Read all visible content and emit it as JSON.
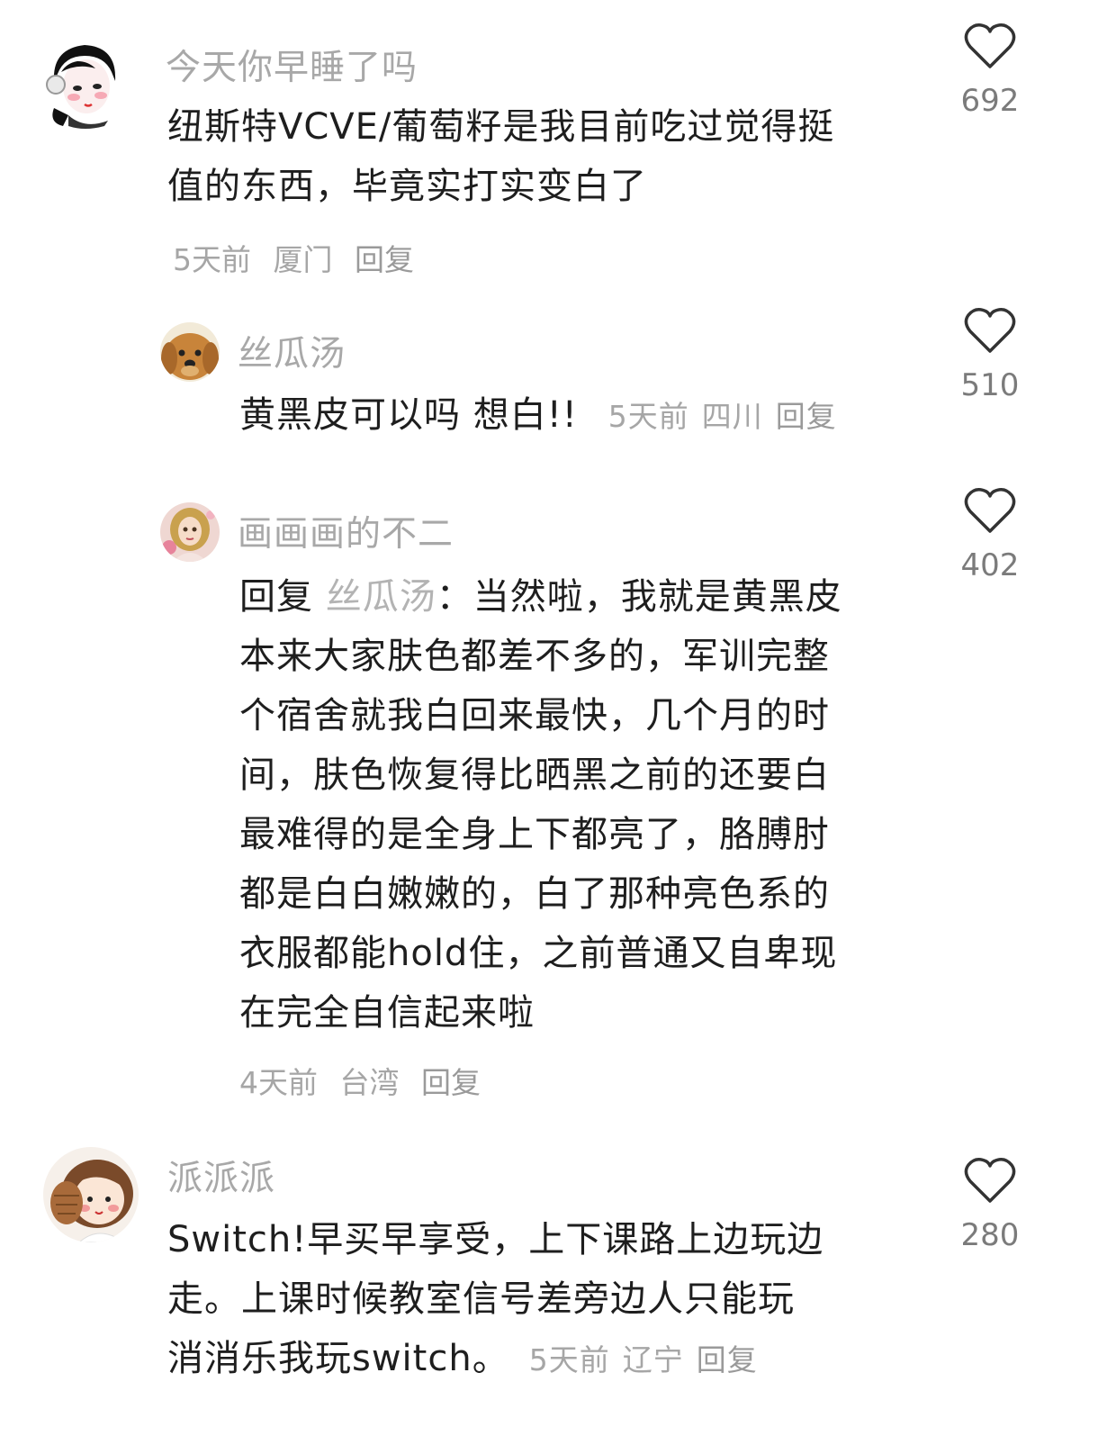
{
  "comments": [
    {
      "username": "今天你早睡了吗",
      "lines": [
        "纽斯特VCVE/葡萄籽是我目前吃过觉得挺",
        "值的东西，毕竟实打实变白了"
      ],
      "time": "5天前",
      "location": "厦门",
      "reply_label": "回复",
      "likes": "692",
      "avatar_icon": "anime-girl-avatar"
    },
    {
      "username": "丝瓜汤",
      "text": "黄黑皮可以吗 想白!!",
      "time": "5天前",
      "location": "四川",
      "reply_label": "回复",
      "likes": "510",
      "avatar_icon": "dog-avatar"
    },
    {
      "username": "画画画的不二",
      "reply_prefix": "回复",
      "mention": "丝瓜汤",
      "first_line_rest": "：当然啦，我就是黄黑皮",
      "lines": [
        "本来大家肤色都差不多的，军训完整",
        "个宿舍就我白回来最快，几个月的时",
        "间，肤色恢复得比晒黑之前的还要白",
        "最难得的是全身上下都亮了，胳膊肘",
        "都是白白嫩嫩的，白了那种亮色系的",
        "衣服都能hold住，之前普通又自卑现",
        "在完全自信起来啦"
      ],
      "time": "4天前",
      "location": "台湾",
      "reply_label": "回复",
      "likes": "402",
      "avatar_icon": "doll-avatar"
    },
    {
      "username": "派派派",
      "lines": [
        "Switch!早买早享受，上下课路上边玩边",
        "走。上课时候教室信号差旁边人只能玩"
      ],
      "last_line": "消消乐我玩switch。",
      "time": "5天前",
      "location": "辽宁",
      "reply_label": "回复",
      "likes": "280",
      "avatar_icon": "cartoon-girl-avatar"
    }
  ],
  "colors": {
    "username": "#a8a8a8",
    "text": "#1e1e1e",
    "meta": "#a6a6a6",
    "heart": "#333333"
  },
  "icons": {
    "like": "heart-outline-icon"
  }
}
